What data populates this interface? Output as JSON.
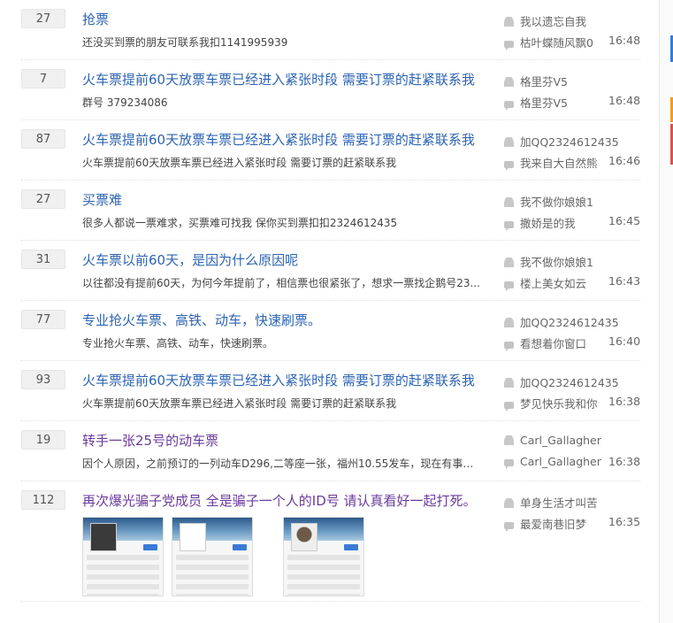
{
  "threads": [
    {
      "replies": "27",
      "title": "抢票",
      "desc": "还没买到票的朋友可联系我扣1141995939",
      "author": "我以遗忘自我",
      "last_reply": "枯叶蝶随风飘0",
      "time": "16:48"
    },
    {
      "replies": "7",
      "title": "火车票提前60天放票车票已经进入紧张时段 需要订票的赶紧联系我",
      "desc": "群号 379234086",
      "author": "格里芬V5",
      "last_reply": "格里芬V5",
      "time": "16:48"
    },
    {
      "replies": "87",
      "title": "火车票提前60天放票车票已经进入紧张时段 需要订票的赶紧联系我",
      "desc": "火车票提前60天放票车票已经进入紧张时段 需要订票的赶紧联系我",
      "author": "加QQ2324612435",
      "last_reply": "我来自大自然熊",
      "time": "16:46"
    },
    {
      "replies": "27",
      "title": "买票难",
      "desc": "很多人都说一票难求，买票难可找我 保你买到票扣扣2324612435",
      "author": "我不做你娘娘1",
      "last_reply": "撒娇是的我",
      "time": "16:45"
    },
    {
      "replies": "31",
      "title": "火车票以前60天，是因为什么原因呢",
      "desc": "以往都没有提前60天，为何今年提前了，相信票也很紧张了，想求一票找企鹅号23...",
      "author": "我不做你娘娘1",
      "last_reply": "楼上美女如云",
      "time": "16:43"
    },
    {
      "replies": "77",
      "title": "专业抢火车票、高铁、动车，快速刷票。",
      "desc": "专业抢火车票、高铁、动车，快速刷票。",
      "author": "加QQ2324612435",
      "last_reply": "看想着你窗口",
      "time": "16:40"
    },
    {
      "replies": "93",
      "title": "火车票提前60天放票车票已经进入紧张时段 需要订票的赶紧联系我",
      "desc": "火车票提前60天放票车票已经进入紧张时段 需要订票的赶紧联系我",
      "author": "加QQ2324612435",
      "last_reply": "梦见快乐我和你",
      "time": "16:38"
    },
    {
      "replies": "19",
      "title": "转手一张25号的动车票",
      "desc": "因个人原因，之前预订的一列动车D296,二等座一张，福州10.55发车，现在有事换...",
      "author": "Carl_Gallagher",
      "last_reply": "Carl_Gallagher",
      "time": "16:38",
      "visited": true
    },
    {
      "replies": "112",
      "title": "再次爆光骗子党成员 全是骗子一个人的ID号 请认真看好一起打死。",
      "desc": "",
      "author": "单身生活才叫苦",
      "last_reply": "最爱南巷旧梦",
      "time": "16:35",
      "visited": true,
      "has_images": true
    }
  ],
  "icons": {
    "author": "person-icon",
    "last_reply": "chat-bubble-icon"
  },
  "colors": {
    "link": "#2d64b3",
    "visited": "#6a3b9e",
    "badge_bg": "#f0f0f0"
  }
}
